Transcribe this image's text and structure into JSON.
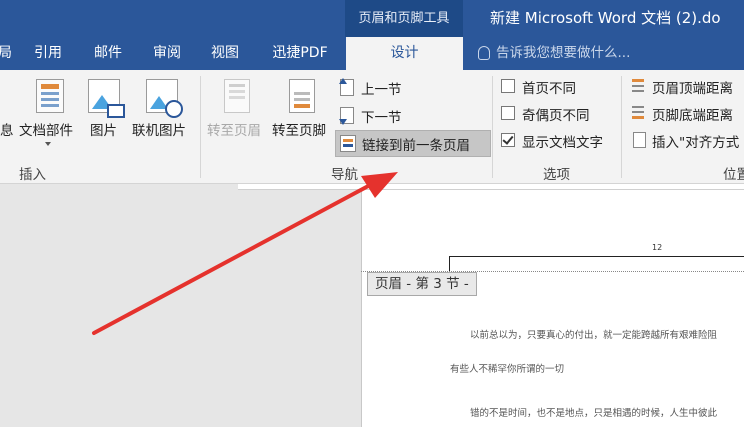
{
  "titlebar": {
    "context_title": "页眉和页脚工具",
    "doc_title": "新建 Microsoft Word 文档 (2).do",
    "tabs": [
      "局",
      "引用",
      "邮件",
      "审阅",
      "视图",
      "迅捷PDF"
    ],
    "active_tab": "设计",
    "tellme": "告诉我您想要做什么..."
  },
  "insert_group": {
    "items": [
      "息",
      "文档部件",
      "图片",
      "联机图片"
    ],
    "label": "插入"
  },
  "nav_group": {
    "goto_header": "转至页眉",
    "goto_footer": "转至页脚",
    "prev": "上一节",
    "next": "下一节",
    "link_prev": "链接到前一条页眉",
    "label": "导航"
  },
  "options_group": {
    "items": [
      {
        "label": "首页不同",
        "checked": false
      },
      {
        "label": "奇偶页不同",
        "checked": false
      },
      {
        "label": "显示文档文字",
        "checked": true
      }
    ],
    "label": "选项"
  },
  "position_group": {
    "items": [
      "页眉顶端距离",
      "页脚底端距离",
      "插入\"对齐方式"
    ],
    "label": "位置"
  },
  "document": {
    "page_number": "12",
    "header_tag": "页眉 - 第 3 节 -",
    "lines": [
      "以前总以为，只要真心的付出，就一定能跨越所有艰难险阻",
      "有些人不稀罕你所谓的一切",
      "错的不是时间，也不是地点，只是相遇的时候，人生中彼此"
    ]
  },
  "colors": {
    "accent": "#2b579a",
    "arrow": "#e5322d"
  }
}
